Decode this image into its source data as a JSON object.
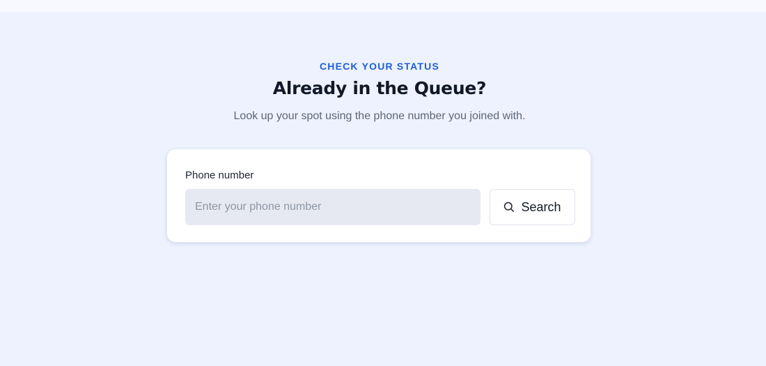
{
  "status_section": {
    "eyebrow": "CHECK YOUR STATUS",
    "title": "Already in the Queue?",
    "subtitle": "Look up your spot using the phone number you joined with."
  },
  "lookup_form": {
    "phone_label": "Phone number",
    "phone_value": "",
    "phone_placeholder": "Enter your phone number",
    "search_label": "Search",
    "search_icon": "search-icon"
  },
  "colors": {
    "accent": "#1d5fd8",
    "page_background": "#edf2fe",
    "card_background": "#ffffff",
    "input_background": "#e6e9f2",
    "heading_text": "#111827",
    "muted_text": "#5d6677"
  }
}
